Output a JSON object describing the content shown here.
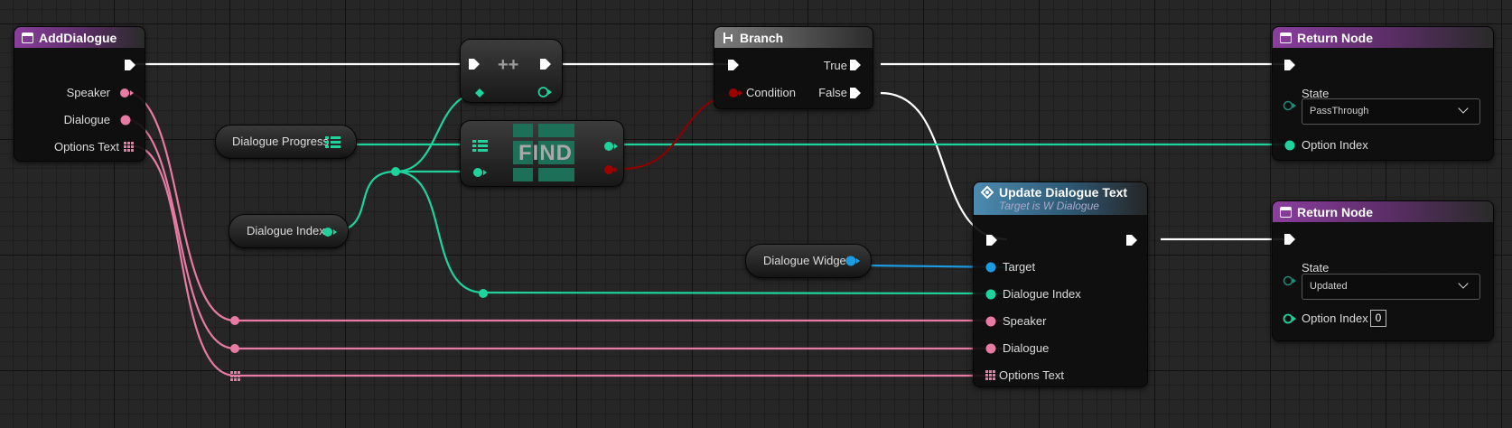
{
  "colors": {
    "exec": "#ffffff",
    "integer": "#1ed49c",
    "string": "#e87ba3",
    "boolean": "#8c0000",
    "object": "#1b9be0",
    "func_header": "#8a3e9d"
  },
  "add_dialogue": {
    "title": "AddDialogue",
    "pins": {
      "speaker": "Speaker",
      "dialogue": "Dialogue",
      "options_text": "Options Text"
    }
  },
  "increment": {
    "symbol": "++"
  },
  "find": {
    "label": "FIND"
  },
  "branch": {
    "title": "Branch",
    "pins": {
      "true": "True",
      "false": "False",
      "condition": "Condition"
    }
  },
  "dialogue_progress": {
    "label": "Dialogue Progress"
  },
  "dialogue_index_var": {
    "label": "Dialogue Index"
  },
  "dialogue_widget_var": {
    "label": "Dialogue Widget"
  },
  "update_text": {
    "title": "Update Dialogue Text",
    "subtitle": "Target is W Dialogue",
    "pins": {
      "target": "Target",
      "dialogue_index": "Dialogue Index",
      "speaker": "Speaker",
      "dialogue": "Dialogue",
      "options_text": "Options Text"
    }
  },
  "return1": {
    "title": "Return Node",
    "state_label": "State",
    "state_value": "PassThrough",
    "option_index_label": "Option Index"
  },
  "return2": {
    "title": "Return Node",
    "state_label": "State",
    "state_value": "Updated",
    "option_index_label": "Option Index",
    "option_index_value": "0"
  }
}
